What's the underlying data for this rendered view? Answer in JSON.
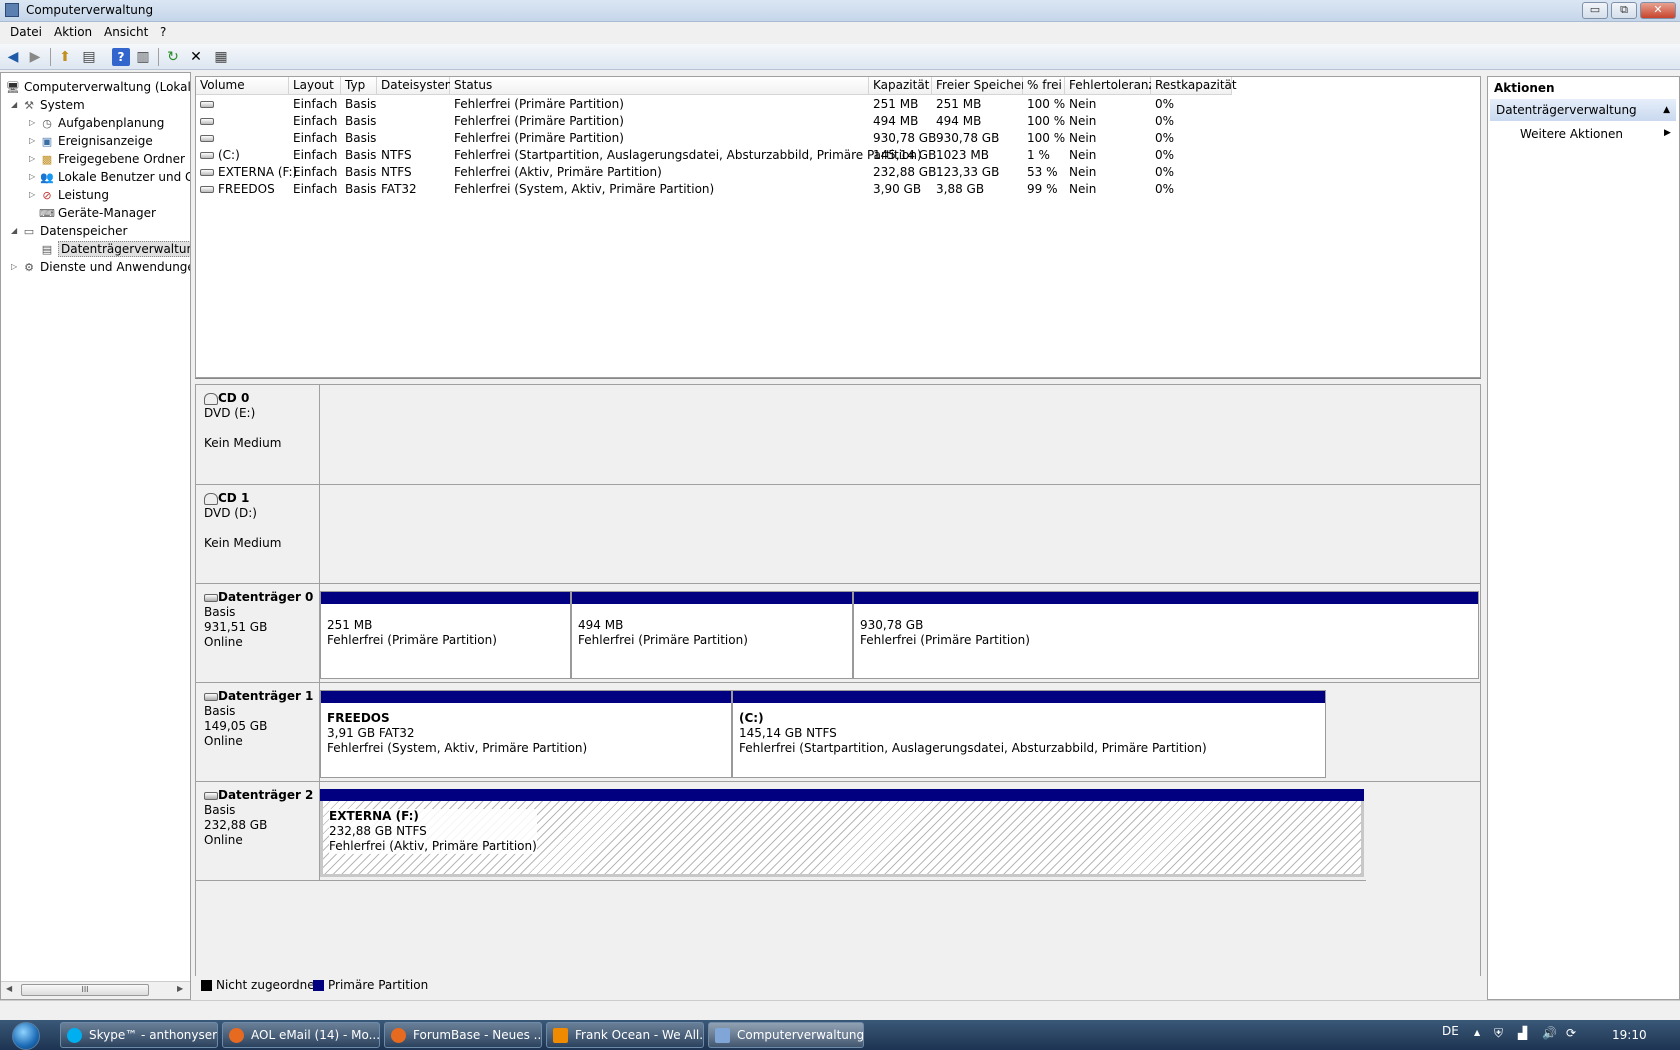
{
  "window": {
    "title": "Computerverwaltung",
    "min": "▭",
    "max": "⧉",
    "close": "✕"
  },
  "menu": [
    "Datei",
    "Aktion",
    "Ansicht",
    "?"
  ],
  "toolbar": {
    "back": "◀",
    "forward": "▶",
    "up": "⬆",
    "show_tree": "▤",
    "help": "?",
    "show_actions": "▥",
    "refresh": "↻",
    "delete": "✕",
    "properties": "▦"
  },
  "tree": {
    "root": "Computerverwaltung (Lokal)",
    "system": "System",
    "aufgabenplanung": "Aufgabenplanung",
    "ereignisanzeige": "Ereignisanzeige",
    "freigegebene": "Freigegebene Ordner",
    "lokale": "Lokale Benutzer und Gr",
    "leistung": "Leistung",
    "geraete": "Geräte-Manager",
    "datenspeicher": "Datenspeicher",
    "datentraeger": "Datenträgerverwaltung",
    "dienste": "Dienste und Anwendungen",
    "scroll_thumb": "III"
  },
  "volume_columns": [
    "Volume",
    "Layout",
    "Typ",
    "Dateisystem",
    "Status",
    "Kapazität",
    "Freier Speicher",
    "% frei",
    "Fehlertoleranz",
    "Restkapazität"
  ],
  "volumes": [
    [
      "",
      "Einfach",
      "Basis",
      "",
      "Fehlerfrei (Primäre Partition)",
      "251 MB",
      "251 MB",
      "100 %",
      "Nein",
      "0%"
    ],
    [
      "",
      "Einfach",
      "Basis",
      "",
      "Fehlerfrei (Primäre Partition)",
      "494 MB",
      "494 MB",
      "100 %",
      "Nein",
      "0%"
    ],
    [
      "",
      "Einfach",
      "Basis",
      "",
      "Fehlerfrei (Primäre Partition)",
      "930,78 GB",
      "930,78 GB",
      "100 %",
      "Nein",
      "0%"
    ],
    [
      "(C:)",
      "Einfach",
      "Basis",
      "NTFS",
      "Fehlerfrei (Startpartition, Auslagerungsdatei, Absturzabbild, Primäre Partition)",
      "145,14 GB",
      "1023 MB",
      "1 %",
      "Nein",
      "0%"
    ],
    [
      "EXTERNA (F:)",
      "Einfach",
      "Basis",
      "NTFS",
      "Fehlerfrei (Aktiv, Primäre Partition)",
      "232,88 GB",
      "123,33 GB",
      "53 %",
      "Nein",
      "0%"
    ],
    [
      "FREEDOS",
      "Einfach",
      "Basis",
      "FAT32",
      "Fehlerfrei (System, Aktiv, Primäre Partition)",
      "3,90 GB",
      "3,88 GB",
      "99 %",
      "Nein",
      "0%"
    ]
  ],
  "disks": {
    "cd0": {
      "name": "CD 0",
      "type": "DVD (E:)",
      "status": "Kein Medium"
    },
    "cd1": {
      "name": "CD 1",
      "type": "DVD (D:)",
      "status": "Kein Medium"
    },
    "d0": {
      "name": "Datenträger 0",
      "type": "Basis",
      "size": "931,51 GB",
      "status": "Online",
      "p1_size": "251 MB",
      "p1_status": "Fehlerfrei (Primäre Partition)",
      "p2_size": "494 MB",
      "p2_status": "Fehlerfrei (Primäre Partition)",
      "p3_size": "930,78 GB",
      "p3_status": "Fehlerfrei (Primäre Partition)"
    },
    "d1": {
      "name": "Datenträger 1",
      "type": "Basis",
      "size": "149,05 GB",
      "status": "Online",
      "p1_name": "FREEDOS",
      "p1_fs": "3,91 GB FAT32",
      "p1_status": "Fehlerfrei (System, Aktiv, Primäre Partition)",
      "p2_name": "(C:)",
      "p2_fs": "145,14 GB NTFS",
      "p2_status": "Fehlerfrei (Startpartition, Auslagerungsdatei, Absturzabbild, Primäre Partition)"
    },
    "d2": {
      "name": "Datenträger 2",
      "type": "Basis",
      "size": "232,88 GB",
      "status": "Online",
      "p1_name": "EXTERNA  (F:)",
      "p1_fs": "232,88 GB NTFS",
      "p1_status": "Fehlerfrei (Aktiv, Primäre Partition)"
    }
  },
  "legend": {
    "unallocated": "Nicht zugeordnet",
    "primary": "Primäre Partition",
    "unallocated_color": "#000000",
    "primary_color": "#000080"
  },
  "actions": {
    "title": "Aktionen",
    "section": "Datenträgerverwaltung",
    "more": "Weitere Aktionen",
    "collapse": "▲",
    "more_arrow": "▶"
  },
  "taskbar": {
    "tasks": [
      "Skype™ - anthonyser...",
      "AOL eMail (14) - Mo...",
      "ForumBase - Neues ...",
      "Frank Ocean - We All...",
      "Computerverwaltung"
    ],
    "lang": "DE",
    "clock": "19:10"
  }
}
